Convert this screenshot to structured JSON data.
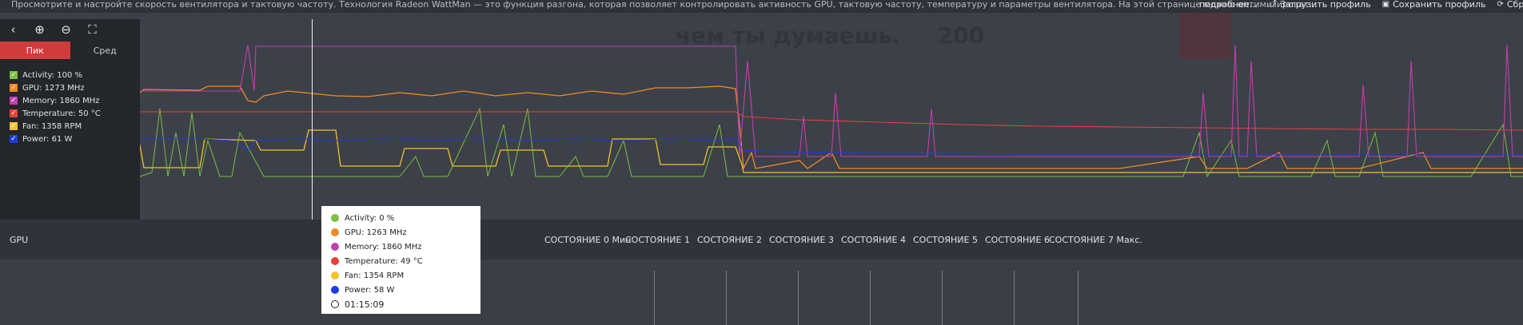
{
  "topbar": {
    "description": "Просмотрите и настройте скорость вентилятора и тактовую частоту. Технология Radeon WattMan — это функция разгона, которая позволяет контролировать активность GPU, тактовую частоту, температуру и параметры вентилятора. На этой странице можно оптимизироват...",
    "more_label": "подробнее...",
    "load_profile_label": "Загрузить профиль",
    "save_profile_label": "Сохранить профиль",
    "reset_label": "Сбр"
  },
  "background": {
    "ad_text": "чем ты думаешь.",
    "ad_number": "200"
  },
  "toolbar": {
    "back_icon": "chevron-left-icon",
    "zoom_in_icon": "zoom-in-icon",
    "zoom_out_icon": "zoom-out-icon",
    "fit_icon": "fit-view-icon"
  },
  "modes": {
    "peak_label": "Пик",
    "avg_label": "Сред",
    "active": "peak"
  },
  "legend": [
    {
      "label": "Activity: 100 %",
      "color": "#7bc043"
    },
    {
      "label": "GPU: 1273 MHz",
      "color": "#f08a24"
    },
    {
      "label": "Memory: 1860 MHz",
      "color": "#c040b0"
    },
    {
      "label": "Temperature: 50 °C",
      "color": "#e8403a"
    },
    {
      "label": "Fan: 1358 RPM",
      "color": "#f2c230"
    },
    {
      "label": "Power: 61 W",
      "color": "#1f3be0"
    }
  ],
  "states": {
    "gpu_label": "GPU",
    "items": [
      "СОСТОЯНИЕ 0 Мин",
      "СОСТОЯНИЕ 1",
      "СОСТОЯНИЕ 2",
      "СОСТОЯНИЕ 3",
      "СОСТОЯНИЕ 4",
      "СОСТОЯНИЕ 5",
      "СОСТОЯНИЕ 6",
      "СОСТОЯНИЕ 7 Макс."
    ]
  },
  "tooltip": {
    "items": [
      {
        "label": "Activity: 0 %",
        "color": "#7bc043"
      },
      {
        "label": "GPU: 1263 MHz",
        "color": "#f08a24"
      },
      {
        "label": "Memory: 1860 MHz",
        "color": "#c040b0"
      },
      {
        "label": "Temperature: 49 °C",
        "color": "#e8403a"
      },
      {
        "label": "Fan: 1354 RPM",
        "color": "#f2c230"
      },
      {
        "label": "Power: 58 W",
        "color": "#1f3be0"
      }
    ],
    "time": "01:15:09"
  }
}
